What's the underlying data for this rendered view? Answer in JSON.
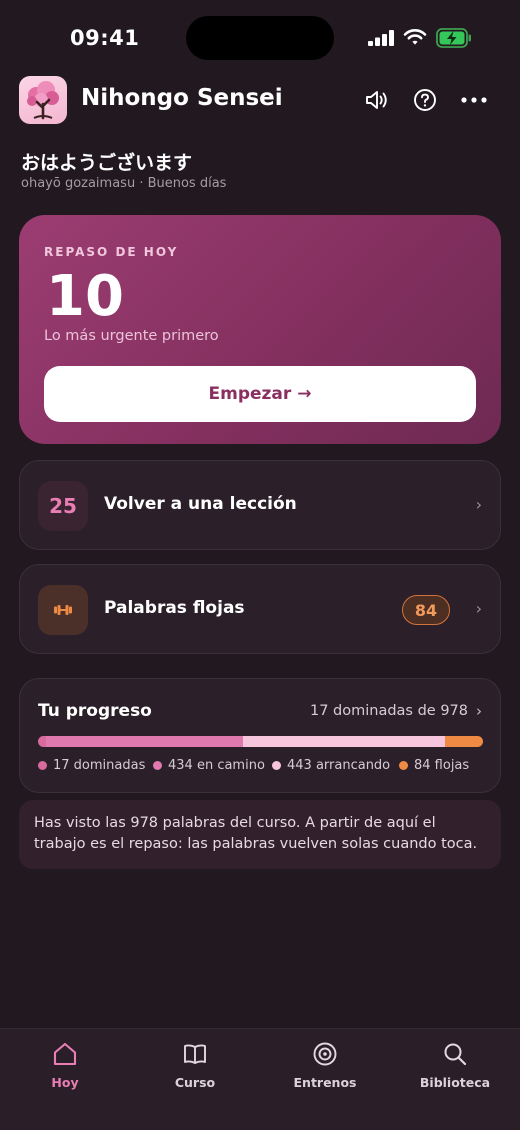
{
  "status_bar": {
    "time": "09:41"
  },
  "header": {
    "app_name": "Nihongo Sensei"
  },
  "greeting": {
    "japanese": "おはようございます",
    "reading": "ohayō gozaimasu · Buenos días"
  },
  "review": {
    "kicker": "REPASO DE HOY",
    "count": "10",
    "subtitle": "Lo más urgente primero",
    "start_label": "Empezar →"
  },
  "lesson_card": {
    "number": "25",
    "label": "Volver a una lección"
  },
  "weak_card": {
    "label": "Palabras flojas",
    "count": "84"
  },
  "progress": {
    "title": "Tu progreso",
    "summary": "17 dominadas de 978",
    "total": 978,
    "segments": [
      {
        "label": "17 dominadas",
        "value": 17,
        "color": "#d96a9e"
      },
      {
        "label": "434 en camino",
        "value": 434,
        "color": "#e07aae"
      },
      {
        "label": "443 arrancando",
        "value": 443,
        "color": "#f7c6dc"
      },
      {
        "label": "84 flojas",
        "value": 84,
        "color": "#ef8a45"
      }
    ]
  },
  "info_note": "Has visto las 978 palabras del curso. A partir de aquí el trabajo es el repaso: las palabras vuelven solas cuando toca.",
  "tabs": [
    {
      "label": "Hoy",
      "icon": "home-icon",
      "active": true
    },
    {
      "label": "Curso",
      "icon": "book-icon",
      "active": false
    },
    {
      "label": "Entrenos",
      "icon": "target-icon",
      "active": false
    },
    {
      "label": "Biblioteca",
      "icon": "search-icon",
      "active": false
    }
  ],
  "colors": {
    "background": "#221920",
    "accent": "#e87eb4",
    "review_card": "#8a3264",
    "warning": "#ef8a45"
  }
}
